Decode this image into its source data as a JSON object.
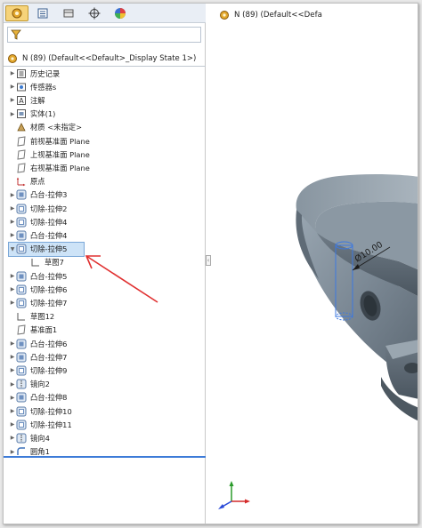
{
  "left_panel": {
    "tabs": [
      {
        "icon": "featuremanager-icon",
        "active": true
      },
      {
        "icon": "propertymanager-icon"
      },
      {
        "icon": "configurationmanager-icon"
      },
      {
        "icon": "dimxpert-icon"
      },
      {
        "icon": "display-manager-icon"
      }
    ],
    "filter_value": "",
    "root": {
      "label": "N (89)  (Default<<Default>_Display State 1>)"
    },
    "items": [
      {
        "label": "历史记录",
        "icon": "history-icon"
      },
      {
        "label": "传感器s",
        "icon": "sensor-icon"
      },
      {
        "label": "注解",
        "icon": "annotation-icon"
      },
      {
        "label": "实体(1)",
        "icon": "solid-bodies-icon"
      },
      {
        "label": "材质 <未指定>",
        "icon": "material-icon"
      },
      {
        "label": "前视基准面 Plane",
        "icon": "plane-icon"
      },
      {
        "label": "上视基准面 Plane",
        "icon": "plane-icon"
      },
      {
        "label": "右视基准面 Plane",
        "icon": "plane-icon"
      },
      {
        "label": "原点",
        "icon": "origin-icon"
      },
      {
        "label": "凸台-拉伸3",
        "icon": "boss-extrude-icon"
      },
      {
        "label": "切除-拉伸2",
        "icon": "cut-extrude-icon"
      },
      {
        "label": "切除-拉伸4",
        "icon": "cut-extrude-icon"
      },
      {
        "label": "凸台-拉伸4",
        "icon": "boss-extrude-icon"
      },
      {
        "label": "切除-拉伸5",
        "icon": "cut-extrude-icon",
        "selected": true
      },
      {
        "label": "草图7",
        "icon": "sketch-icon"
      },
      {
        "label": "凸台-拉伸5",
        "icon": "boss-extrude-icon"
      },
      {
        "label": "切除-拉伸6",
        "icon": "cut-extrude-icon"
      },
      {
        "label": "切除-拉伸7",
        "icon": "cut-extrude-icon"
      },
      {
        "label": "草图12",
        "icon": "sketch-icon"
      },
      {
        "label": "基准面1",
        "icon": "plane-icon"
      },
      {
        "label": "凸台-拉伸6",
        "icon": "boss-extrude-icon"
      },
      {
        "label": "凸台-拉伸7",
        "icon": "boss-extrude-icon"
      },
      {
        "label": "切除-拉伸9",
        "icon": "cut-extrude-icon"
      },
      {
        "label": "镜向2",
        "icon": "mirror-icon"
      },
      {
        "label": "凸台-拉伸8",
        "icon": "boss-extrude-icon"
      },
      {
        "label": "切除-拉伸10",
        "icon": "cut-extrude-icon"
      },
      {
        "label": "切除-拉伸11",
        "icon": "cut-extrude-icon"
      },
      {
        "label": "镜向4",
        "icon": "mirror-icon"
      },
      {
        "label": "圆角1",
        "icon": "fillet-icon"
      }
    ]
  },
  "viewport": {
    "header": "N (89)  (Default<<Defa",
    "dimension_label": "Ø10.00",
    "model_color": "#7e8c98",
    "annotation_arrow_color": "#e03030"
  }
}
